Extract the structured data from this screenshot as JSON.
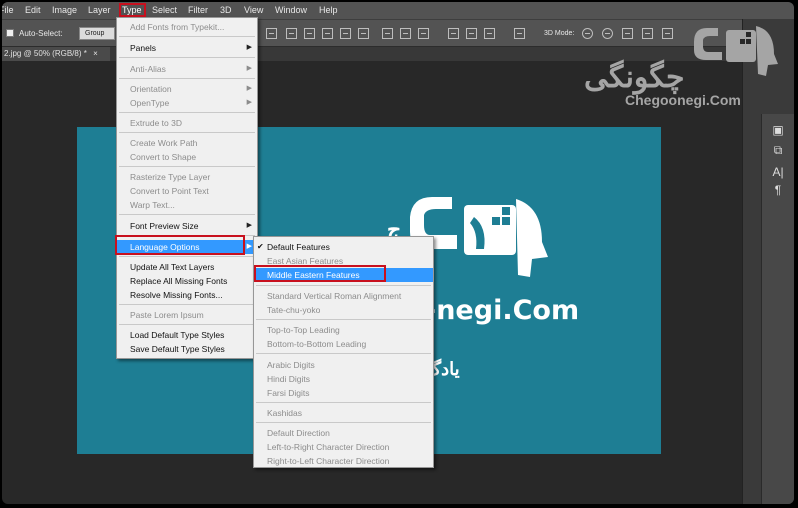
{
  "menubar": {
    "items": [
      "File",
      "Edit",
      "Image",
      "Layer",
      "Type",
      "Select",
      "Filter",
      "3D",
      "View",
      "Window",
      "Help"
    ]
  },
  "options": {
    "auto_select_label": "Auto-Select:",
    "group_value": "Group",
    "mode_label": "3D Mode:"
  },
  "document": {
    "tab_label": "2.jpg @ 50% (RGB/8) *",
    "close_glyph": "×"
  },
  "canvas": {
    "brand_text": "-negi.Com",
    "persian_text": "یادگ",
    "brand_left": "ج"
  },
  "watermark": {
    "persian": "چگونگی",
    "english": "Chegoonegi.Com"
  },
  "type_menu": {
    "items": [
      {
        "label": "Add Fonts from Typekit...",
        "disabled": true
      },
      {
        "label": "Panels",
        "submenu": true
      },
      {
        "label": "Anti-Alias",
        "disabled": true,
        "submenu": true
      },
      {
        "label": "Orientation",
        "disabled": true,
        "submenu": true
      },
      {
        "label": "OpenType",
        "disabled": true,
        "submenu": true
      },
      {
        "label": "Extrude to 3D",
        "disabled": true
      },
      {
        "label": "Create Work Path",
        "disabled": true
      },
      {
        "label": "Convert to Shape",
        "disabled": true
      },
      {
        "label": "Rasterize Type Layer",
        "disabled": true
      },
      {
        "label": "Convert to Point Text",
        "disabled": true
      },
      {
        "label": "Warp Text...",
        "disabled": true
      },
      {
        "label": "Font Preview Size",
        "submenu": true
      },
      {
        "label": "Language Options",
        "submenu": true,
        "highlighted": true
      },
      {
        "label": "Update All Text Layers"
      },
      {
        "label": "Replace All Missing Fonts"
      },
      {
        "label": "Resolve Missing Fonts..."
      },
      {
        "label": "Paste Lorem Ipsum",
        "disabled": true
      },
      {
        "label": "Load Default Type Styles"
      },
      {
        "label": "Save Default Type Styles"
      }
    ]
  },
  "language_menu": {
    "items": [
      {
        "label": "Default Features",
        "checked": true
      },
      {
        "label": "East Asian Features",
        "disabled": true
      },
      {
        "label": "Middle Eastern Features",
        "highlighted": true
      },
      {
        "label": "Standard Vertical Roman Alignment",
        "disabled": true
      },
      {
        "label": "Tate-chu-yoko",
        "disabled": true
      },
      {
        "label": "Top-to-Top Leading",
        "disabled": true
      },
      {
        "label": "Bottom-to-Bottom Leading",
        "disabled": true
      },
      {
        "label": "Arabic Digits",
        "disabled": true
      },
      {
        "label": "Hindi Digits",
        "disabled": true
      },
      {
        "label": "Farsi Digits",
        "disabled": true
      },
      {
        "label": "Kashidas",
        "disabled": true
      },
      {
        "label": "Default Direction",
        "disabled": true
      },
      {
        "label": "Left-to-Right Character Direction",
        "disabled": true
      },
      {
        "label": "Right-to-Left Character Direction",
        "disabled": true
      }
    ]
  },
  "panel_icons": [
    "A|",
    "¶"
  ],
  "colors": {
    "highlight": "#3399ff",
    "annotation_red": "#c8101e",
    "canvas_teal": "#1e7e94"
  }
}
